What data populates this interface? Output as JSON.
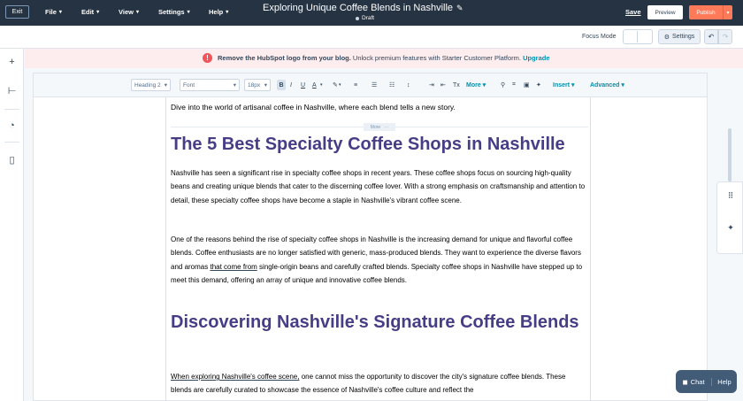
{
  "topbar": {
    "exit_label": "Exit",
    "menus": [
      "File",
      "Edit",
      "View",
      "Settings",
      "Help"
    ],
    "title": "Exploring Unique Coffee Blends in Nashville",
    "status": "Draft",
    "save_label": "Save",
    "preview_label": "Preview",
    "publish_label": "Publish"
  },
  "secondbar": {
    "focus_mode_label": "Focus Mode",
    "settings_label": "Settings"
  },
  "banner": {
    "bold_text": "Remove the HubSpot logo from your blog.",
    "text": " Unlock premium features with Starter Customer Platform.",
    "link_text": "Upgrade"
  },
  "toolbar": {
    "heading_select": "Heading 2",
    "font_select": "Font",
    "size_select": "18px",
    "bold": "B",
    "italic": "I",
    "underline": "U",
    "text_color": "A",
    "more_label": "More",
    "insert_label": "Insert",
    "advanced_label": "Advanced"
  },
  "document": {
    "intro": "Dive into the world of artisanal coffee in Nashville, where each blend tells a new story.",
    "more_tag": "More",
    "heading1": "The 5 Best Specialty Coffee Shops in Nashville",
    "para1": "Nashville has seen a significant rise in specialty coffee shops in recent years. These coffee shops focus on sourcing high-quality beans and creating unique blends that cater to the discerning coffee lover. With a strong emphasis on craftsmanship and attention to detail, these specialty coffee shops have become a staple in Nashville's vibrant coffee scene.",
    "para2_a": "One of the reasons behind the rise of specialty coffee shops in Nashville is the increasing demand for unique and flavorful coffee blends. Coffee enthusiasts are no longer satisfied with generic, mass-produced blends. They want to experience the diverse flavors and aromas ",
    "para2_ul": "that come from",
    "para2_b": " single-origin beans and carefully crafted blends. Specialty coffee shops in Nashville have stepped up to meet this demand, offering an array of unique and innovative coffee blends.",
    "heading2": "Discovering Nashville's Signature Coffee Blends",
    "para3_ul": "When exploring Nashville's coffee scene,",
    "para3_b": " one cannot miss the opportunity to discover the city's signature coffee blends. These blends are carefully curated to showcase the essence of Nashville's coffee culture and reflect the"
  },
  "chat": {
    "chat_label": "Chat",
    "help_label": "Help"
  },
  "colors": {
    "topbar": "#253342",
    "accent": "#ff7a59",
    "heading": "#473d87",
    "link": "#0091ae"
  }
}
